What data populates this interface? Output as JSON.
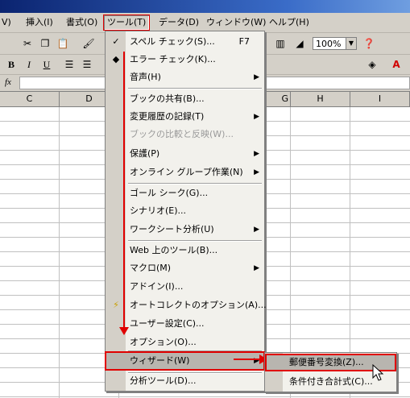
{
  "menubar": {
    "items": [
      {
        "label": "V)"
      },
      {
        "label": "挿入(I)"
      },
      {
        "label": "書式(O)"
      },
      {
        "label": "ツール(T)"
      },
      {
        "label": "データ(D)"
      },
      {
        "label": "ウィンドウ(W)"
      },
      {
        "label": "ヘルプ(H)"
      }
    ]
  },
  "toolbar": {
    "zoom": "100%",
    "icons": [
      "cut-icon",
      "copy-icon",
      "paste-icon",
      "format-painter-icon",
      "bold-icon",
      "italic-icon",
      "underline-icon",
      "align-left-icon",
      "chart-icon",
      "drawing-icon",
      "help-icon",
      "fill-color-icon",
      "font-color-icon"
    ],
    "bold": "B",
    "italic": "I",
    "underline": "U"
  },
  "formula": {
    "fx": "fx",
    "value": ""
  },
  "columns": [
    "C",
    "D",
    "G",
    "H",
    "I"
  ],
  "tools_menu": {
    "items": [
      {
        "label": "スペル チェック(S)...",
        "shortcut": "F7"
      },
      {
        "label": "エラー チェック(K)..."
      },
      {
        "label": "音声(H)"
      },
      {
        "label": "ブックの共有(B)..."
      },
      {
        "label": "変更履歴の記録(T)"
      },
      {
        "label": "ブックの比較と反映(W)..."
      },
      {
        "label": "保護(P)"
      },
      {
        "label": "オンライン グループ作業(N)"
      },
      {
        "label": "ゴール シーク(G)..."
      },
      {
        "label": "シナリオ(E)..."
      },
      {
        "label": "ワークシート分析(U)"
      },
      {
        "label": "Web 上のツール(B)..."
      },
      {
        "label": "マクロ(M)"
      },
      {
        "label": "アドイン(I)..."
      },
      {
        "label": "オートコレクトのオプション(A)..."
      },
      {
        "label": "ユーザー設定(C)..."
      },
      {
        "label": "オプション(O)..."
      },
      {
        "label": "ウィザード(W)"
      },
      {
        "label": "分析ツール(D)..."
      }
    ]
  },
  "wizard_submenu": {
    "items": [
      {
        "label": "郵便番号変換(Z)..."
      },
      {
        "label": "条件付き合計式(C)..."
      }
    ]
  },
  "colors": {
    "highlight": "#e00000",
    "menu_bg": "#f2f1ec",
    "chrome": "#d4d0c8"
  }
}
